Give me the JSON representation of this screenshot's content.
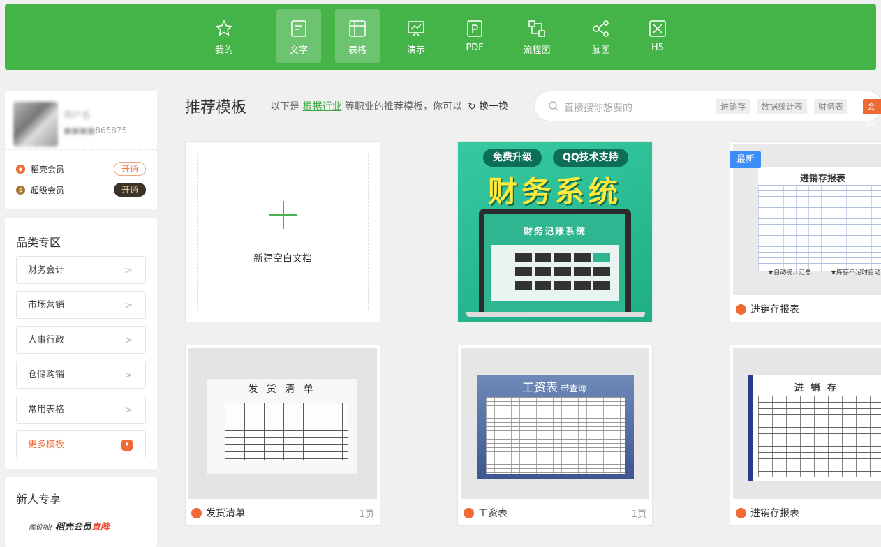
{
  "toolbar": {
    "items": [
      {
        "label": "我的",
        "icon": "star-icon",
        "active": false
      },
      {
        "label": "文字",
        "icon": "document-icon",
        "active": true
      },
      {
        "label": "表格",
        "icon": "table-icon",
        "active": true
      },
      {
        "label": "演示",
        "icon": "presentation-icon",
        "active": false
      },
      {
        "label": "PDF",
        "icon": "pdf-icon",
        "active": false
      },
      {
        "label": "流程图",
        "icon": "flowchart-icon",
        "active": false
      },
      {
        "label": "脑图",
        "icon": "mindmap-icon",
        "active": false
      },
      {
        "label": "H5",
        "icon": "h5-icon",
        "active": false
      }
    ],
    "bg_color": "#45b448"
  },
  "user": {
    "name": "用户名",
    "id_suffix": "865875",
    "members": [
      {
        "label": "稻壳会员",
        "button": "开通"
      },
      {
        "label": "超级会员",
        "button": "开通"
      }
    ]
  },
  "categories": {
    "title": "品类专区",
    "items": [
      "财务会计",
      "市场营销",
      "人事行政",
      "仓储购销",
      "常用表格"
    ],
    "more": "更多模板"
  },
  "newuser": {
    "title": "新人专享",
    "banner_small": "库价啦!",
    "banner_main": "稻壳会员",
    "banner_red": "直降"
  },
  "recommend": {
    "title": "推荐模板",
    "sub_pre": "以下是",
    "sub_link": "根据行业",
    "sub_post": "等职业的推荐模板，你可以",
    "refresh": "换一换"
  },
  "search": {
    "placeholder": "直接搜你想要的",
    "tags": [
      "进销存",
      "数据统计表",
      "财务表",
      "会员"
    ]
  },
  "templates": {
    "blank_label": "新建空白文档",
    "finance": {
      "pill1": "免费升级",
      "pill2": "QQ技术支持",
      "headline": "财务系统",
      "screen_title": "财务记账系统"
    },
    "inventory": {
      "badge": "最新",
      "sheet_title": "进销存报表",
      "bottom_left": "★自动统计汇总",
      "bottom_right": "★库存不足时自动高",
      "label": "进销存报表"
    },
    "row2": [
      {
        "label": "发货清单",
        "pages": "1页",
        "sheet_title": "发 货 清 单"
      },
      {
        "label": "工资表",
        "pages": "1页",
        "sheet_title": "工资表",
        "sheet_sub": "-带查询"
      },
      {
        "label": "进销存报表",
        "pages": "",
        "sheet_title": "进 销 存"
      }
    ]
  }
}
